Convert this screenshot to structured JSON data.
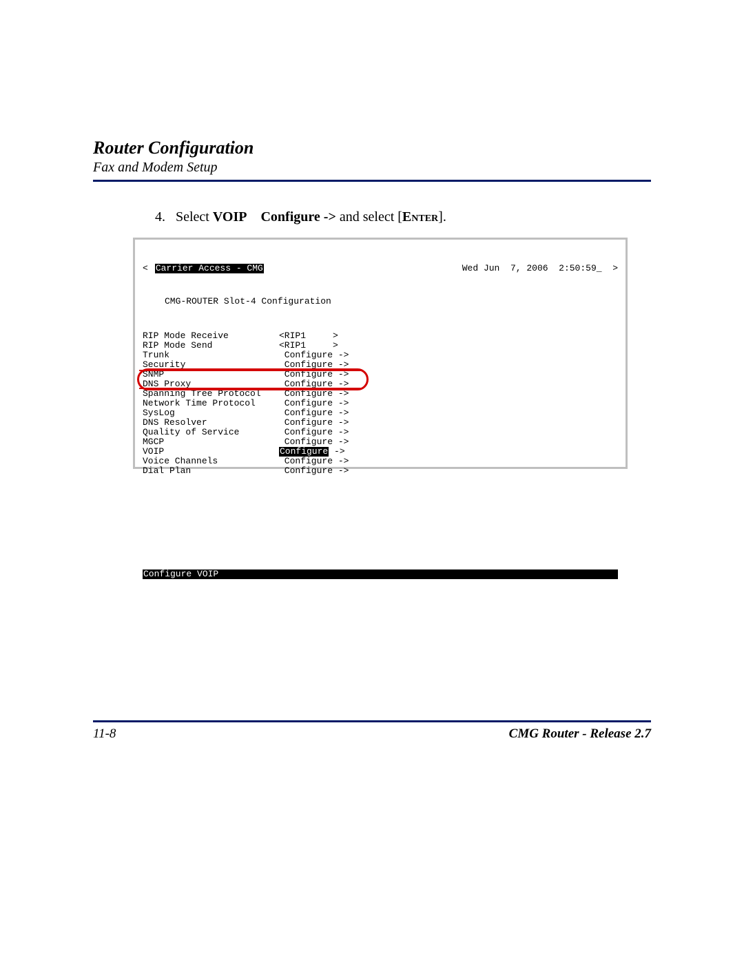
{
  "header": {
    "title": "Router Configuration",
    "subtitle": "Fax and Modem Setup"
  },
  "step": {
    "number": "4.",
    "prefix": "Select ",
    "bold1": "VOIP",
    "bold2": "Configure ->",
    "mid": " and select [",
    "enter": "Enter",
    "suffix": "]."
  },
  "terminal": {
    "left_arrow": "<",
    "right_arrow": ">",
    "banner": "Carrier Access - CMG",
    "timestamp": "Wed Jun  7, 2006  2:50:59_",
    "subtitle": "CMG-ROUTER Slot-4 Configuration",
    "rows": [
      {
        "label": "RIP Mode Receive",
        "value": "<RIP1     >"
      },
      {
        "label": "RIP Mode Send",
        "value": "<RIP1     >"
      },
      {
        "label": "Trunk",
        "value": " Configure ->"
      },
      {
        "label": "Security",
        "value": " Configure ->"
      },
      {
        "label": "SNMP",
        "value": " Configure ->"
      },
      {
        "label": "DNS Proxy",
        "value": " Configure ->"
      },
      {
        "label": "Spanning Tree Protocol",
        "value": " Configure ->"
      },
      {
        "label": "Network Time Protocol",
        "value": " Configure ->"
      },
      {
        "label": "SysLog",
        "value": " Configure ->"
      },
      {
        "label": "DNS Resolver",
        "value": " Configure ->"
      },
      {
        "label": "Quality of Service",
        "value": " Configure ->"
      },
      {
        "label": "MGCP",
        "value": " Configure ->"
      },
      {
        "label": "VOIP",
        "value": "Configure",
        "highlight": true,
        "tail": " ->"
      },
      {
        "label": "Voice Channels",
        "value": " Configure ->"
      },
      {
        "label": "Dial Plan",
        "value": " Configure ->"
      }
    ],
    "statusbar": "Configure VOIP"
  },
  "footer": {
    "page": "11-8",
    "release": "CMG Router - Release 2.7"
  }
}
